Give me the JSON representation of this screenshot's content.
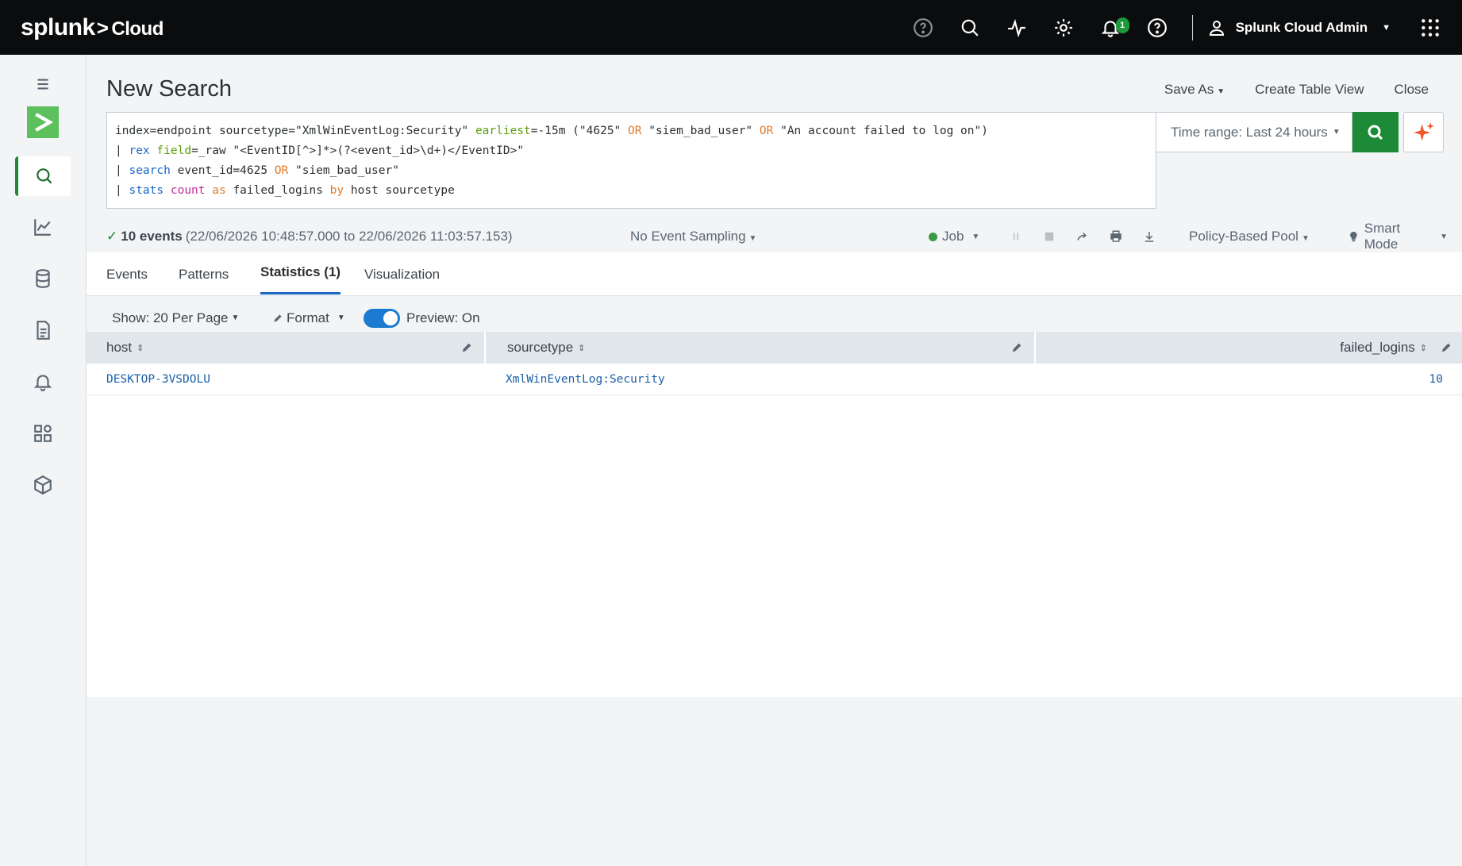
{
  "header": {
    "logo_main": "splunk",
    "logo_sep": ">",
    "logo_sub": "Cloud",
    "notification_count": "1",
    "user_name": "Splunk Cloud Admin"
  },
  "page": {
    "title": "New Search",
    "save_as": "Save As",
    "create_table_view": "Create Table View",
    "close": "Close"
  },
  "search": {
    "line1": {
      "a": "index=endpoint sourcetype=\"XmlWinEventLog:Security\" ",
      "b": "earliest",
      "c": "=-15m (\"4625\" ",
      "d": "OR",
      "e": " \"siem_bad_user\" ",
      "f": "OR",
      "g": " \"An account failed to log on\")"
    },
    "line2": {
      "a": "| ",
      "b": "rex",
      "c": " ",
      "d": "field",
      "e": "=_raw \"<EventID[^>]*>(?<event_id>\\d+)</EventID>\""
    },
    "line3": {
      "a": "| ",
      "b": "search",
      "c": " event_id=4625 ",
      "d": "OR",
      "e": " \"siem_bad_user\""
    },
    "line4": {
      "a": "| ",
      "b": "stats",
      "c": " ",
      "d": "count",
      "e": " ",
      "f": "as",
      "g": " failed_logins ",
      "h": "by",
      "i": " host sourcetype"
    },
    "time_range": "Time range: Last 24 hours"
  },
  "status": {
    "check": "✓",
    "count": "10 events",
    "range": "(22/06/2026 10:48:57.000 to 22/06/2026 11:03:57.153)",
    "sampling": "No Event Sampling",
    "job": "Job",
    "pool": "Policy-Based Pool",
    "mode": "Smart Mode"
  },
  "tabs": [
    {
      "label": "Events"
    },
    {
      "label": "Patterns"
    },
    {
      "label": "Statistics (1)"
    },
    {
      "label": "Visualization"
    }
  ],
  "table_options": {
    "show": "Show: 20 Per Page",
    "format": "Format",
    "preview": "Preview: On"
  },
  "table": {
    "columns": [
      "host",
      "sourcetype",
      "failed_logins"
    ],
    "rows": [
      {
        "host": "DESKTOP-3VSDOLU",
        "sourcetype": "XmlWinEventLog:Security",
        "failed_logins": "10"
      }
    ]
  },
  "colors": {
    "accent_green": "#1c8a36",
    "link_blue": "#1a5fa8",
    "topbar": "#0b0c0e"
  }
}
